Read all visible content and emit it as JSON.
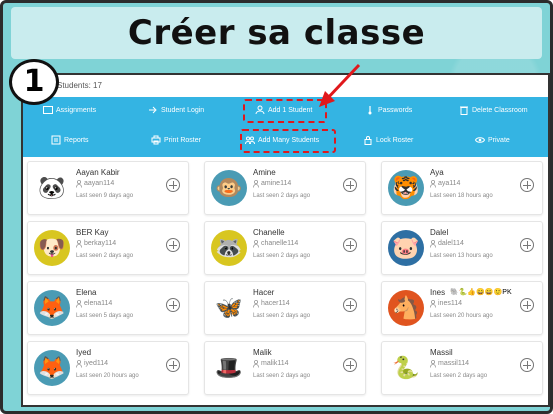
{
  "slide": {
    "title": "Créer sa classe",
    "step_number": "1",
    "students_count": "Students: 17"
  },
  "toolbar": {
    "row1": [
      {
        "label": "Assignments",
        "icon": "folder-icon"
      },
      {
        "label": "Student Login",
        "icon": "login-icon"
      },
      {
        "label": "Add 1 Student",
        "icon": "add-user-icon"
      },
      {
        "label": "Passwords",
        "icon": "key-icon"
      },
      {
        "label": "Delete Classroom",
        "icon": "trash-icon"
      }
    ],
    "row2": [
      {
        "label": "Reports",
        "icon": "report-icon"
      },
      {
        "label": "Print Roster",
        "icon": "printer-icon"
      },
      {
        "label": "Add Many Students",
        "icon": "add-users-icon"
      },
      {
        "label": "Lock Roster",
        "icon": "lock-icon"
      },
      {
        "label": "Private",
        "icon": "eye-icon"
      }
    ]
  },
  "students": [
    {
      "name": "Aayan Kabir",
      "username": "aayan114",
      "last_seen": "Last seen 9 days ago",
      "avatar": "panda",
      "bg": "#ffffff"
    },
    {
      "name": "Amine",
      "username": "amine114",
      "last_seen": "Last seen 2 days ago",
      "avatar": "monkey",
      "bg": "#4a9bb4"
    },
    {
      "name": "Aya",
      "username": "aya114",
      "last_seen": "Last seen 18 hours ago",
      "avatar": "tiger",
      "bg": "#4a9bb4"
    },
    {
      "name": "BER Kay",
      "username": "berkay114",
      "last_seen": "Last seen 2 days ago",
      "avatar": "dog",
      "bg": "#d8c620"
    },
    {
      "name": "Chanelle",
      "username": "chanelle114",
      "last_seen": "Last seen 2 days ago",
      "avatar": "raccoon",
      "bg": "#d8c620"
    },
    {
      "name": "Dalel",
      "username": "dalel114",
      "last_seen": "Last seen 13 hours ago",
      "avatar": "pig",
      "bg": "#2e6fa3"
    },
    {
      "name": "Elena",
      "username": "elena114",
      "last_seen": "Last seen 5 days ago",
      "avatar": "fox",
      "bg": "#4a9bb4"
    },
    {
      "name": "Hacer",
      "username": "hacer114",
      "last_seen": "Last seen 2 days ago",
      "avatar": "moth",
      "bg": "#ffffff"
    },
    {
      "name": "Ines",
      "username": "ines114",
      "last_seen": "Last seen 20 hours ago",
      "avatar": "horse",
      "bg": "#e0541f",
      "badges": "🐘🐍👍😄😄🙂PK"
    },
    {
      "name": "Iyed",
      "username": "iyed114",
      "last_seen": "Last seen 20 hours ago",
      "avatar": "fox2",
      "bg": "#4a9bb4"
    },
    {
      "name": "Malik",
      "username": "malik114",
      "last_seen": "Last seen 2 days ago",
      "avatar": "gentleman",
      "bg": "#ffffff"
    },
    {
      "name": "Massil",
      "username": "massil114",
      "last_seen": "Last seen 2 days ago",
      "avatar": "snake",
      "bg": "#ffffff"
    }
  ],
  "colors": {
    "toolbar": "#34b4e3",
    "highlight": "#e0181c"
  }
}
